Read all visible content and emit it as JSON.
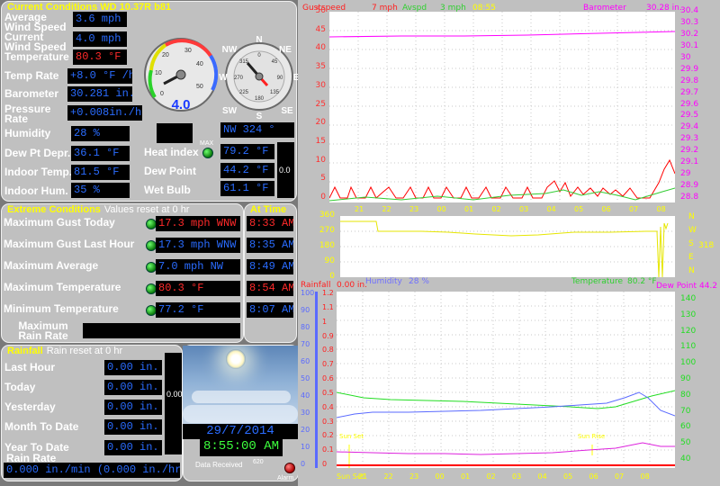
{
  "current": {
    "title": "Current Conditions  WD 10.37R b81",
    "avg_wind": {
      "label": "Average Wind Speed",
      "value": "3.6 mph"
    },
    "cur_wind": {
      "label": "Current Wind Speed",
      "value": "4.0 mph"
    },
    "temperature": {
      "label": "Temperature",
      "value": "80.3 °F"
    },
    "temp_rate": {
      "label": "Temp Rate",
      "value": "+8.0 °F /hr"
    },
    "barometer": {
      "label": "Barometer",
      "value": "30.281 in."
    },
    "pressure_rate": {
      "label": "Pressure Rate",
      "value": "+0.008in./hr"
    },
    "humidity": {
      "label": "Humidity",
      "value": "28 %"
    },
    "dewpt_depr": {
      "label": "Dew Pt Depr.",
      "value": "36.1 °F"
    },
    "indoor_temp": {
      "label": "Indoor Temp.",
      "value": "81.5 °F"
    },
    "indoor_hum": {
      "label": "Indoor Hum.",
      "value": "35 %"
    },
    "wind_dir": "NW  324 °",
    "heat_index": {
      "label": "Heat index",
      "value": "79.2 °F"
    },
    "dew_point": {
      "label": "Dew Point",
      "value": "44.2 °F"
    },
    "wet_bulb": {
      "label": "Wet Bulb",
      "value": "61.1 °F"
    },
    "mini_box": "0.0",
    "max_label": "MAX",
    "speedo_value": "4.0",
    "speedo_ticks": [
      "0",
      "10",
      "20",
      "30",
      "40",
      "50"
    ],
    "compass_labels": {
      "n": "N",
      "ne": "NE",
      "e": "E",
      "se": "SE",
      "s": "S",
      "sw": "SW",
      "w": "W",
      "nw": "NW"
    },
    "compass_ticks": [
      "0",
      "45",
      "90",
      "135",
      "180",
      "225",
      "270",
      "315"
    ]
  },
  "extreme": {
    "title": "Extreme Conditions",
    "subtitle": "Values reset at 0 hr",
    "at_time_title": "At Time",
    "rows": [
      {
        "label": "Maximum Gust Today",
        "value": "17.3 mph WNW",
        "time": "8:33 AM",
        "color": "red"
      },
      {
        "label": "Maximum Gust Last Hour",
        "value": "17.3 mph WNW",
        "time": "8:35 AM",
        "color": "blue"
      },
      {
        "label": "Maximum Average",
        "value": "7.0 mph  NW",
        "time": "8:49 AM",
        "color": "blue"
      },
      {
        "label": "Maximum Temperature",
        "value": "80.3 °F",
        "time": "8:54 AM",
        "color": "red"
      },
      {
        "label": "Minimum Temperature",
        "value": "77.2 °F",
        "time": "8:07 AM",
        "color": "blue"
      }
    ],
    "max_rain_rate": {
      "label": "Maximum Rain Rate",
      "value": ""
    }
  },
  "rainfall": {
    "title": "Rainfall",
    "subtitle": "Rain reset at 0 hr",
    "rows": [
      {
        "label": "Last Hour",
        "value": "0.00 in."
      },
      {
        "label": "Today",
        "value": "0.00 in."
      },
      {
        "label": "Yesterday",
        "value": "0.00 in."
      },
      {
        "label": "Month To Date",
        "value": "0.00 in."
      },
      {
        "label": "Year To Date",
        "value": "0.00 in."
      }
    ],
    "rain_rate_label": "Rain Rate",
    "rain_rate_value": "0.000 in./min (0.000 in./hr)",
    "side_value": "0.00"
  },
  "weather": {
    "date": "29/7/2014",
    "time": "8:55:00 AM",
    "data_received_label": "Data Received",
    "data_received_count": "620",
    "alarm_label": "Alarm"
  },
  "graphs": {
    "top": {
      "gust_label": "Gustspeed",
      "gust_value": "7 mph",
      "avg_label": "Avspd",
      "avg_value": "3 mph",
      "time_label": "08:55",
      "baro_label": "Barometer",
      "baro_value": "30.28 in.",
      "left_ticks": [
        "50",
        "45",
        "40",
        "35",
        "30",
        "25",
        "20",
        "15",
        "10",
        "5",
        "0"
      ],
      "right_ticks": [
        "30.4",
        "30.3",
        "30.2",
        "30.1",
        "30",
        "29.9",
        "29.8",
        "29.7",
        "29.6",
        "29.5",
        "29.4",
        "29.3",
        "29.2",
        "29.1",
        "29",
        "28.9",
        "28.8"
      ],
      "hours": [
        "21",
        "22",
        "23",
        "00",
        "01",
        "02",
        "03",
        "04",
        "05",
        "06",
        "07",
        "08"
      ]
    },
    "dir": {
      "left_ticks": [
        "360",
        "270",
        "180",
        "90",
        "0"
      ],
      "right_letters": [
        "N",
        "W",
        "S",
        "E",
        "N"
      ],
      "current_dir": "318"
    },
    "bottom": {
      "rain_label": "Rainfall",
      "rain_value": "0.00 in.",
      "hum_label": "Humidity",
      "hum_value": "28 %",
      "temp_label": "Temperature",
      "temp_value": "80.2 °F",
      "dew_label": "Dew Point",
      "dew_value": "44.2",
      "hum_ticks": [
        "100",
        "90",
        "80",
        "70",
        "60",
        "50",
        "40",
        "30",
        "20",
        "10",
        "0"
      ],
      "rain_ticks": [
        "1.2",
        "1.1",
        "1",
        "0.9",
        "0.8",
        "0.7",
        "0.6",
        "0.5",
        "0.4",
        "0.3",
        "0.2",
        "0.1",
        "0"
      ],
      "temp_ticks": [
        "140",
        "130",
        "120",
        "110",
        "100",
        "90",
        "80",
        "70",
        "60",
        "50",
        "40"
      ],
      "sun_set": "Sun Set",
      "sun_rise": "Sun Rise",
      "hours": [
        "Sun Set",
        "21",
        "22",
        "23",
        "00",
        "01",
        "02",
        "03",
        "04",
        "05",
        "06",
        "07",
        "08"
      ]
    }
  },
  "colors": {
    "panel": "#c0c0c0",
    "title": "#ffff00",
    "value_blue": "#2a6cff",
    "value_red": "#ff2a2a",
    "value_green": "#3dff3d"
  }
}
